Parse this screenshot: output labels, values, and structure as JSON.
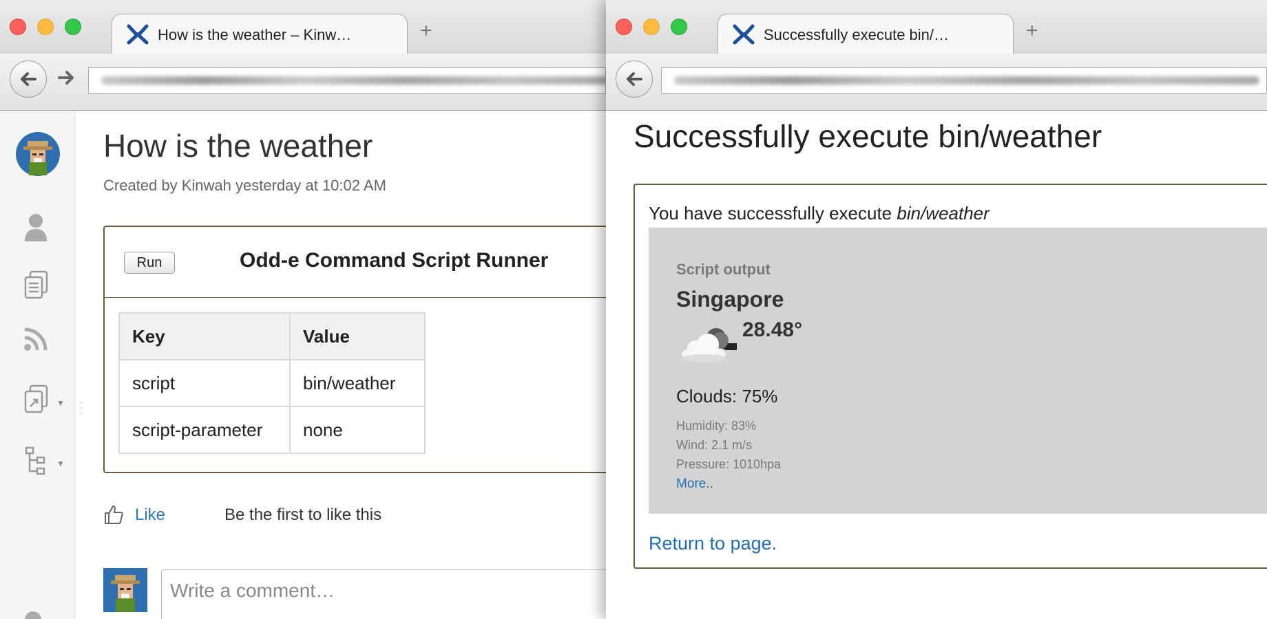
{
  "left_window": {
    "tab_title": "How is the weather – Kinw…",
    "new_tab": "+",
    "page": {
      "title": "How is the weather",
      "byline": "Created by Kinwah yesterday at 10:02 AM",
      "macro": {
        "run_label": "Run",
        "title": "Odd-e Command Script Runner",
        "table": {
          "headers": [
            "Key",
            "Value"
          ],
          "rows": [
            [
              "script",
              "bin/weather"
            ],
            [
              "script-parameter",
              "none"
            ]
          ]
        }
      },
      "like_label": "Like",
      "like_text": "Be the first to like this",
      "comment_placeholder": "Write a comment…"
    }
  },
  "right_window": {
    "tab_title": "Successfully execute bin/…",
    "new_tab": "+",
    "page": {
      "title": "Successfully execute bin/weather",
      "message_prefix": "You have successfully execute ",
      "message_script": "bin/weather",
      "output": {
        "label": "Script output",
        "city": "Singapore",
        "temperature": "28.48°",
        "clouds": "Clouds: 75%",
        "humidity": "Humidity: 83%",
        "wind": "Wind: 2.1 m/s",
        "pressure": "Pressure: 1010hpa",
        "more_link": "More.."
      },
      "return_link": "Return to page."
    }
  },
  "colors": {
    "link": "#2b78c2",
    "macro_border": "#6b5a3a",
    "output_bg": "#d3d3d3"
  },
  "icons": [
    "user-avatar-icon",
    "profile-icon",
    "pages-icon",
    "rss-icon",
    "export-icon",
    "tree-icon",
    "cloud-sun-icon",
    "thumbs-up-icon",
    "confluence-logo-icon"
  ]
}
